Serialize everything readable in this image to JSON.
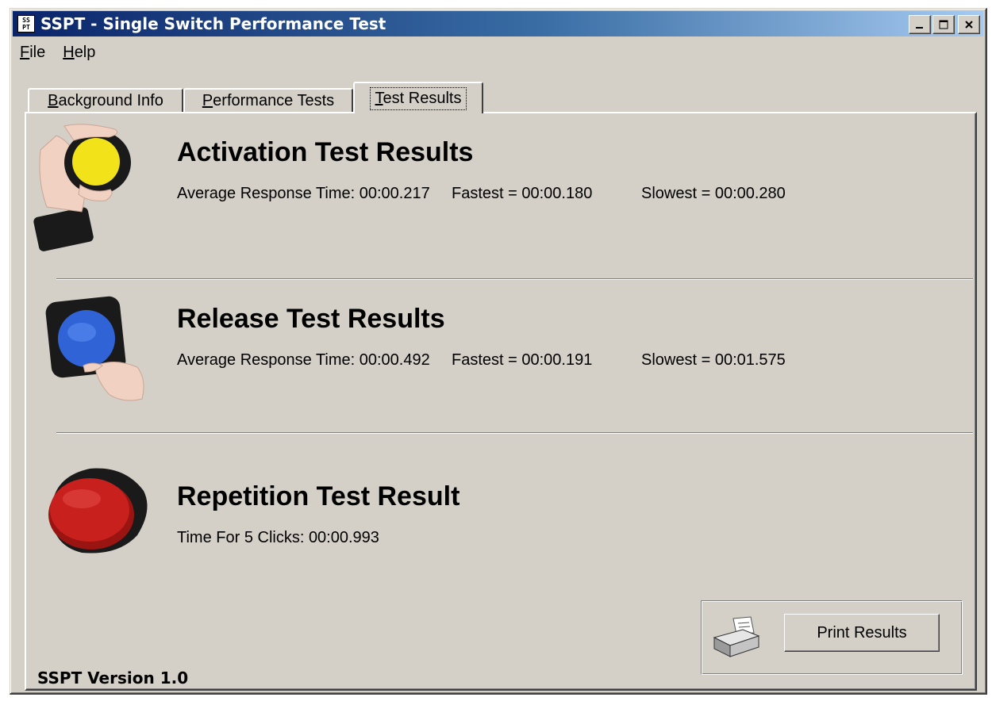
{
  "window": {
    "title": "SSPT - Single Switch Performance Test",
    "app_icon_text": "SSPT",
    "minimize": "_",
    "maximize": "□",
    "close": "✕"
  },
  "menu": {
    "items": [
      {
        "label": "File",
        "accel": "F",
        "rest": "ile"
      },
      {
        "label": "Help",
        "accel": "H",
        "rest": "elp"
      }
    ]
  },
  "tabs": [
    {
      "label": "Background Info",
      "accel": "B",
      "rest": "ackground Info",
      "active": false
    },
    {
      "label": "Performance Tests",
      "accel": "P",
      "rest": "erformance Tests",
      "active": false
    },
    {
      "label": "Test Results",
      "accel": "T",
      "rest": "est Results",
      "active": true
    }
  ],
  "activation": {
    "title": "Activation Test Results",
    "average": "Average Response Time: 00:00.217",
    "fastest": "Fastest = 00:00.180",
    "slowest": "Slowest = 00:00.280",
    "switch_color": "#f2e21a",
    "icon": "yellow-switch-hand-icon"
  },
  "release": {
    "title": "Release Test Results",
    "average": "Average Response Time: 00:00.492",
    "fastest": "Fastest = 00:00.191",
    "slowest": "Slowest = 00:01.575",
    "switch_color": "#2f63d6",
    "icon": "blue-switch-hand-icon"
  },
  "repetition": {
    "title": "Repetition Test Result",
    "time": "Time For 5 Clicks: 00:00.993",
    "switch_color": "#c8201c",
    "icon": "red-switch-icon"
  },
  "footer": {
    "version": "SSPT Version 1.0",
    "print_label": "Print Results",
    "printer_icon": "printer-icon"
  },
  "colors": {
    "face": "#d4d0c8",
    "titlebar_start": "#0a246a",
    "titlebar_end": "#a6caf0"
  }
}
